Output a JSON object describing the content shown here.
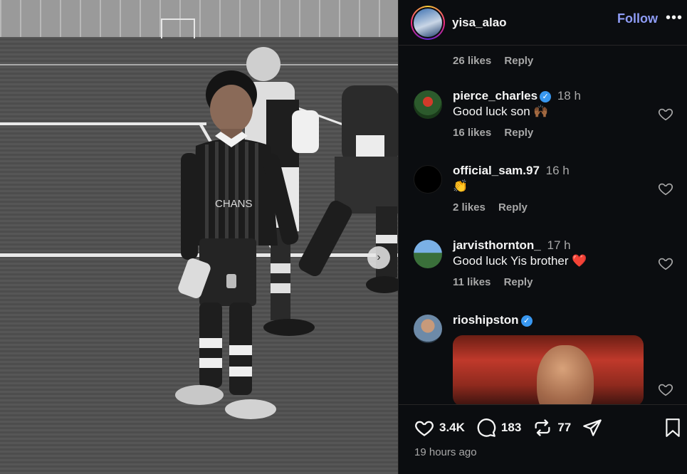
{
  "post": {
    "username": "yisa_alao",
    "follow_label": "Follow",
    "more_label": "•••",
    "timestamp": "19 hours ago"
  },
  "photo": {
    "jersey_text": "CHANS",
    "next_arrow": "›"
  },
  "previous_comment": {
    "likes": "26 likes",
    "reply": "Reply"
  },
  "comments": [
    {
      "username": "pierce_charles",
      "verified": true,
      "time": "18 h",
      "text": "Good luck son 🙌🏾",
      "likes": "16 likes",
      "reply": "Reply"
    },
    {
      "username": "official_sam.97",
      "verified": false,
      "time": "16 h",
      "text": "👏",
      "likes": "2 likes",
      "reply": "Reply"
    },
    {
      "username": "jarvisthornton_",
      "verified": false,
      "time": "17 h",
      "text": "Good luck Yis brother ❤️",
      "likes": "11 likes",
      "reply": "Reply"
    },
    {
      "username": "rioshipston",
      "verified": true,
      "time": "",
      "text": "",
      "likes": "",
      "reply": ""
    }
  ],
  "actions": {
    "likes": "3.4K",
    "comments": "183",
    "reposts": "77"
  },
  "icons": {
    "verified": "verified-badge-icon",
    "heart": "heart-icon",
    "comment": "comment-icon",
    "repost": "repost-icon",
    "share": "share-icon",
    "bookmark": "bookmark-icon"
  },
  "colors": {
    "follow": "#8e9cf6",
    "verified": "#3897f0",
    "background": "#0b0d10"
  }
}
